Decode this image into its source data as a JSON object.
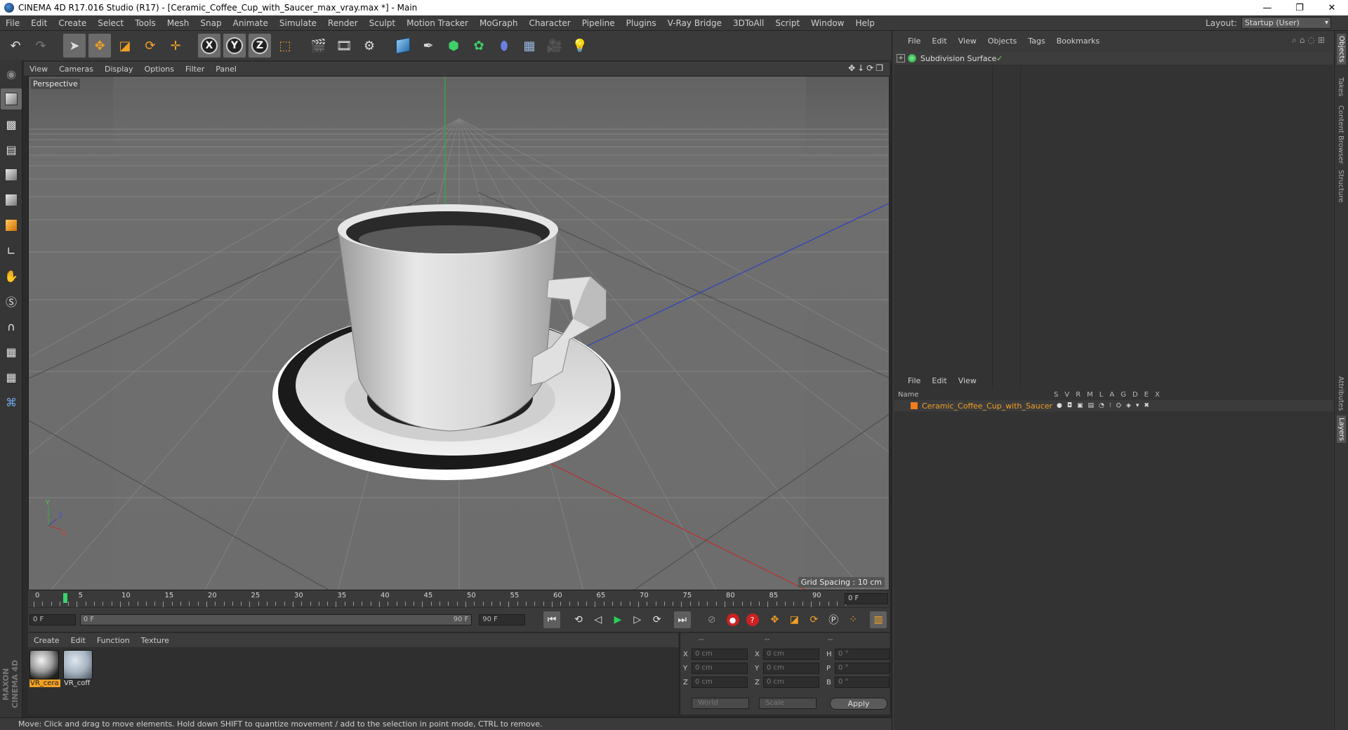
{
  "window": {
    "title": "CINEMA 4D R17.016 Studio (R17) - [Ceramic_Coffee_Cup_with_Saucer_max_vray.max *] - Main",
    "controls": [
      "—",
      "❐",
      "✕"
    ]
  },
  "menubar": {
    "items": [
      "File",
      "Edit",
      "Create",
      "Select",
      "Tools",
      "Mesh",
      "Snap",
      "Animate",
      "Simulate",
      "Render",
      "Sculpt",
      "Motion Tracker",
      "MoGraph",
      "Character",
      "Pipeline",
      "Plugins",
      "V-Ray Bridge",
      "3DToAll",
      "Script",
      "Window",
      "Help"
    ],
    "layout_label": "Layout:",
    "layout_value": "Startup (User)"
  },
  "viewport": {
    "menu": [
      "View",
      "Cameras",
      "Display",
      "Options",
      "Filter",
      "Panel"
    ],
    "camera_label": "Perspective",
    "grid_spacing": "Grid Spacing : 10 cm",
    "axis_labels": {
      "y": "Y",
      "x": "X",
      "z": "Z"
    }
  },
  "timeline": {
    "ticks": [
      "0",
      "5",
      "10",
      "15",
      "20",
      "25",
      "30",
      "35",
      "40",
      "45",
      "50",
      "55",
      "60",
      "65",
      "70",
      "75",
      "80",
      "85",
      "90"
    ],
    "current_frame_field": "0 F"
  },
  "transport": {
    "start_frame": "0 F",
    "range_start": "0 F",
    "range_end": "90 F",
    "end_frame": "90 F"
  },
  "materials": {
    "menu": [
      "Create",
      "Edit",
      "Function",
      "Texture"
    ],
    "items": [
      {
        "label": "VR_cera",
        "selected": true
      },
      {
        "label": "VR_coff",
        "selected": false
      }
    ]
  },
  "coordinates": {
    "headers": [
      "--",
      "--",
      "--"
    ],
    "rows": [
      {
        "a": "X",
        "av": "0 cm",
        "b": "X",
        "bv": "0 cm",
        "c": "H",
        "cv": "0 °"
      },
      {
        "a": "Y",
        "av": "0 cm",
        "b": "Y",
        "bv": "0 cm",
        "c": "P",
        "cv": "0 °"
      },
      {
        "a": "Z",
        "av": "0 cm",
        "b": "Z",
        "bv": "0 cm",
        "c": "B",
        "cv": "0 °"
      }
    ],
    "mode1": "World",
    "mode2": "Scale",
    "apply": "Apply"
  },
  "statusbar": {
    "text": "Move: Click and drag to move elements. Hold down SHIFT to quantize movement / add to the selection in point mode, CTRL to remove."
  },
  "objects": {
    "menu": [
      "File",
      "Edit",
      "View",
      "Objects",
      "Tags",
      "Bookmarks"
    ],
    "items": [
      {
        "name": "Subdivision Surface",
        "expand": "+",
        "check": "✓"
      }
    ]
  },
  "layers": {
    "menu": [
      "File",
      "Edit",
      "View"
    ],
    "header_name": "Name",
    "flags": [
      "S",
      "V",
      "R",
      "M",
      "L",
      "A",
      "G",
      "D",
      "E",
      "X"
    ],
    "items": [
      {
        "name": "Ceramic_Coffee_Cup_with_Saucer",
        "color": "#f07d1a"
      }
    ]
  },
  "side_tabs": [
    "Objects",
    "Takes",
    "Content Browser",
    "Structure",
    "Attributes",
    "Layers"
  ],
  "maxon_logo": "MAXON CINEMA 4D",
  "colors": {
    "accent": "#f2a024",
    "play": "#27d05a",
    "axis_x": "#c0302a",
    "axis_y": "#30b040",
    "axis_z": "#3040c0"
  }
}
